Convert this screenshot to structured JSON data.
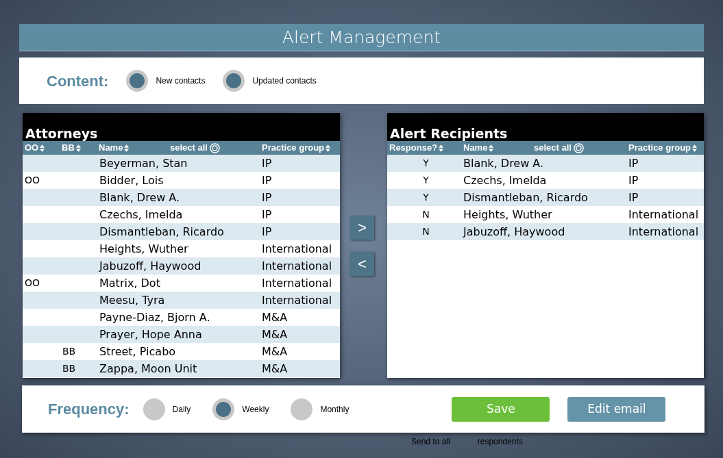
{
  "window": {
    "title": "Alert Management"
  },
  "content": {
    "label": "Content:",
    "options": [
      {
        "label": "New contacts",
        "checked": true
      },
      {
        "label": "Updated contacts",
        "checked": true
      }
    ]
  },
  "attorneys": {
    "title": "Attorneys",
    "columns": [
      "OO",
      "BB",
      "Name",
      "Practice group"
    ],
    "select_all": "select all",
    "rows": [
      {
        "oo": "",
        "bb": "",
        "name": "Beyerman, Stan",
        "group": "IP"
      },
      {
        "oo": "OO",
        "bb": "",
        "name": "Bidder, Lois",
        "group": "IP"
      },
      {
        "oo": "",
        "bb": "",
        "name": "Blank, Drew A.",
        "group": "IP"
      },
      {
        "oo": "",
        "bb": "",
        "name": "Czechs, Imelda",
        "group": "IP"
      },
      {
        "oo": "",
        "bb": "",
        "name": "Dismantleban, Ricardo",
        "group": "IP"
      },
      {
        "oo": "",
        "bb": "",
        "name": "Heights, Wuther",
        "group": "International"
      },
      {
        "oo": "",
        "bb": "",
        "name": "Jabuzoff, Haywood",
        "group": "International"
      },
      {
        "oo": "OO",
        "bb": "",
        "name": "Matrix, Dot",
        "group": "International"
      },
      {
        "oo": "",
        "bb": "",
        "name": "Meesu, Tyra",
        "group": "International"
      },
      {
        "oo": "",
        "bb": "",
        "name": "Payne-Diaz, Bjorn A.",
        "group": "M&A"
      },
      {
        "oo": "",
        "bb": "",
        "name": "Prayer, Hope Anna",
        "group": "M&A"
      },
      {
        "oo": "",
        "bb": "BB",
        "name": "Street, Picabo",
        "group": "M&A"
      },
      {
        "oo": "",
        "bb": "BB",
        "name": "Zappa, Moon Unit",
        "group": "M&A"
      }
    ]
  },
  "move_buttons": [
    ">",
    "<"
  ],
  "recipients": {
    "title": "Alert Recipients",
    "columns": [
      "Response?",
      "Name",
      "Practice group"
    ],
    "select_all": "select all",
    "rows": [
      {
        "response": "Y",
        "name": "Blank, Drew A.",
        "group": "IP"
      },
      {
        "response": "Y",
        "name": "Czechs, Imelda",
        "group": "IP"
      },
      {
        "response": "Y",
        "name": "Dismantleban, Ricardo",
        "group": "IP"
      },
      {
        "response": "N",
        "name": "Heights, Wuther",
        "group": "International"
      },
      {
        "response": "N",
        "name": "Jabuzoff, Haywood",
        "group": "International"
      }
    ]
  },
  "frequency": {
    "label": "Frequency:",
    "options": [
      {
        "label": "Daily",
        "selected": false
      },
      {
        "label": "Weekly",
        "selected": true
      },
      {
        "label": "Monthly",
        "selected": false
      }
    ]
  },
  "buttons": [
    {
      "kind": "save",
      "label": "Save"
    },
    {
      "kind": "edit",
      "label": "Edit email"
    }
  ],
  "behind_texts": [
    "Send to all",
    "respondents"
  ]
}
